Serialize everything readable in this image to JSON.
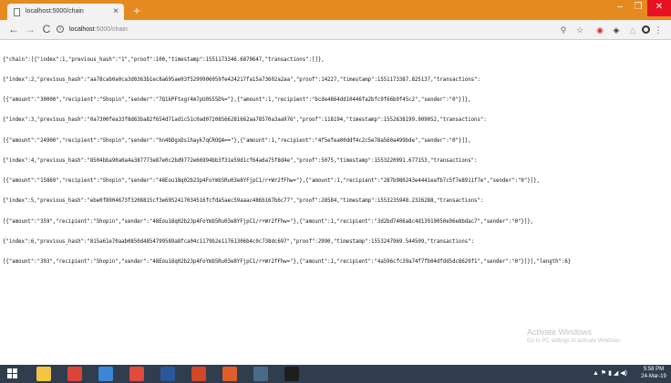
{
  "browser": {
    "tab_title": "localhost:5000/chain",
    "tab_close": "×",
    "new_tab": "+",
    "window_controls": {
      "minimize": "–",
      "maximize": "❐",
      "close": "✕"
    },
    "nav": {
      "back": "←",
      "forward": "→",
      "reload": "C"
    },
    "url_host": "localhost",
    "url_rest": ":5000/chain",
    "tools": {
      "search": "⚲",
      "star": "☆",
      "ext1": "◉",
      "ext2": "◈",
      "ext3": "△",
      "menu": "⋮"
    }
  },
  "page": {
    "json_lines": [
      "{\"chain\":[{\"index\":1,\"previous_hash\":\"1\",\"proof\":100,\"timestamp\":1551173346.6879647,\"transactions\":[]},",
      "{\"index\":2,\"previous_hash\":\"aa78cab0a0ca3d0363b1ec8a695ae03f5299906059fe424217fa15a73602a2aa\",\"proof\":14227,\"timestamp\":1551173387.825137,\"transactions\":",
      "[{\"amount\":\"30000\",\"recipient\":\"Shopin\",\"sender\":\"7Q1kPFtxgr4m7pU0S55D%=\"},{\"amount\":1,\"recipient\":\"bcde4864dd10446fa2bfc9f66b9f45c2\",\"sender\":\"0\"}]},",
      "{\"index\":3,\"previous_hash\":\"0a7300fea33f8d63ba82f654d71ad1c51c0ad07208566281662aa78570a3aa976\",\"proof\":118194,\"timestamp\":1552638199.909052,\"transactions\":",
      "[{\"amount\":\"24900\",\"recipient\":\"Shopin\",\"sender\":\"hn4bDgxDs1hayk7qCROQA==\"},{\"amount\":1,\"recipient\":\"4f5efea00ddf4c2c5e78a560a499bde\",\"sender\":\"0\"}]},",
      "{\"index\":4,\"previous_hash\":\"8504bba90a0a4a387773e87e0c2bd9772e66994bb3f31e59d1cf64a6a75f8d4e\",\"proof\":5075,\"timestamp\":1553220991.677153,\"transactions\":",
      "[{\"amount\":\"15869\",\"recipient\":\"Shopin\",\"sender\":\"48Eou18q02b23p4FoYmb5Ru03e8YFjpC1/r+Wr2fFhw=\"},{\"amount\":1,\"recipient\":\"287b980243e4441eafb7c5f7e8911f7e\",\"sender\":\"0\"}]},",
      "{\"index\":5,\"previous_hash\":\"ebe0f8904673f3208815cf3e6952417034516fcfda5aec59aaac486b167b6c77\",\"proof\":28584,\"timestamp\":1553235948.2326288,\"transactions\":",
      "[{\"amount\":\"359\",\"recipient\":\"Shopin\",\"sender\":\"48Eou18q02b23p4FoYmb5Ru03e8YFjpC1/r+Wr2fFhw=\"},{\"amount\":1,\"recipient\":\"3d2bd7406a8c4d13919050e96e8bdac7\",\"sender\":\"0\"}]},",
      "{\"index\":6,\"previous_hash\":\"815a61e70aab0850d4854799589a8fca04c1179b2e11761306b4c0c738dc697\",\"proof\":2990,\"timestamp\":1553247969.544509,\"transactions\":",
      "[{\"amount\":\"393\",\"recipient\":\"Shopin\",\"sender\":\"48Eou18q02b23p4FoYmb5Ru03e8YFjpC1/r+Wr2fFhw=\"},{\"amount\":1,\"recipient\":\"4a596cfc39a74f7fb04dfdd5dc8629f1\",\"sender\":\"0\"}]}],\"length\":6}"
    ]
  },
  "watermark": {
    "title": "Activate Windows",
    "subtitle": "Go to PC settings to activate Windows."
  },
  "taskbar": {
    "apps": [
      {
        "name": "file-explorer-icon",
        "color": "#f4c542"
      },
      {
        "name": "chrome-icon",
        "color": "#db4437"
      },
      {
        "name": "media-player-icon",
        "color": "#3a87d6"
      },
      {
        "name": "paint-icon",
        "color": "#e04a3a"
      },
      {
        "name": "word-icon",
        "color": "#2b579a"
      },
      {
        "name": "powerpoint-icon",
        "color": "#d24726"
      },
      {
        "name": "tools-icon",
        "color": "#e05c2a"
      },
      {
        "name": "settings-icon",
        "color": "#4a6a8a"
      },
      {
        "name": "terminal-icon",
        "color": "#1e1e1e"
      }
    ],
    "tray": "▲  ⚑  ▮  ◢  ◀)",
    "time": "5:58 PM",
    "date": "24-Mar-19"
  },
  "colors": {
    "titlebar": "#e58a1f",
    "taskbar": "#2f3d4e",
    "close_button": "#e81123"
  }
}
